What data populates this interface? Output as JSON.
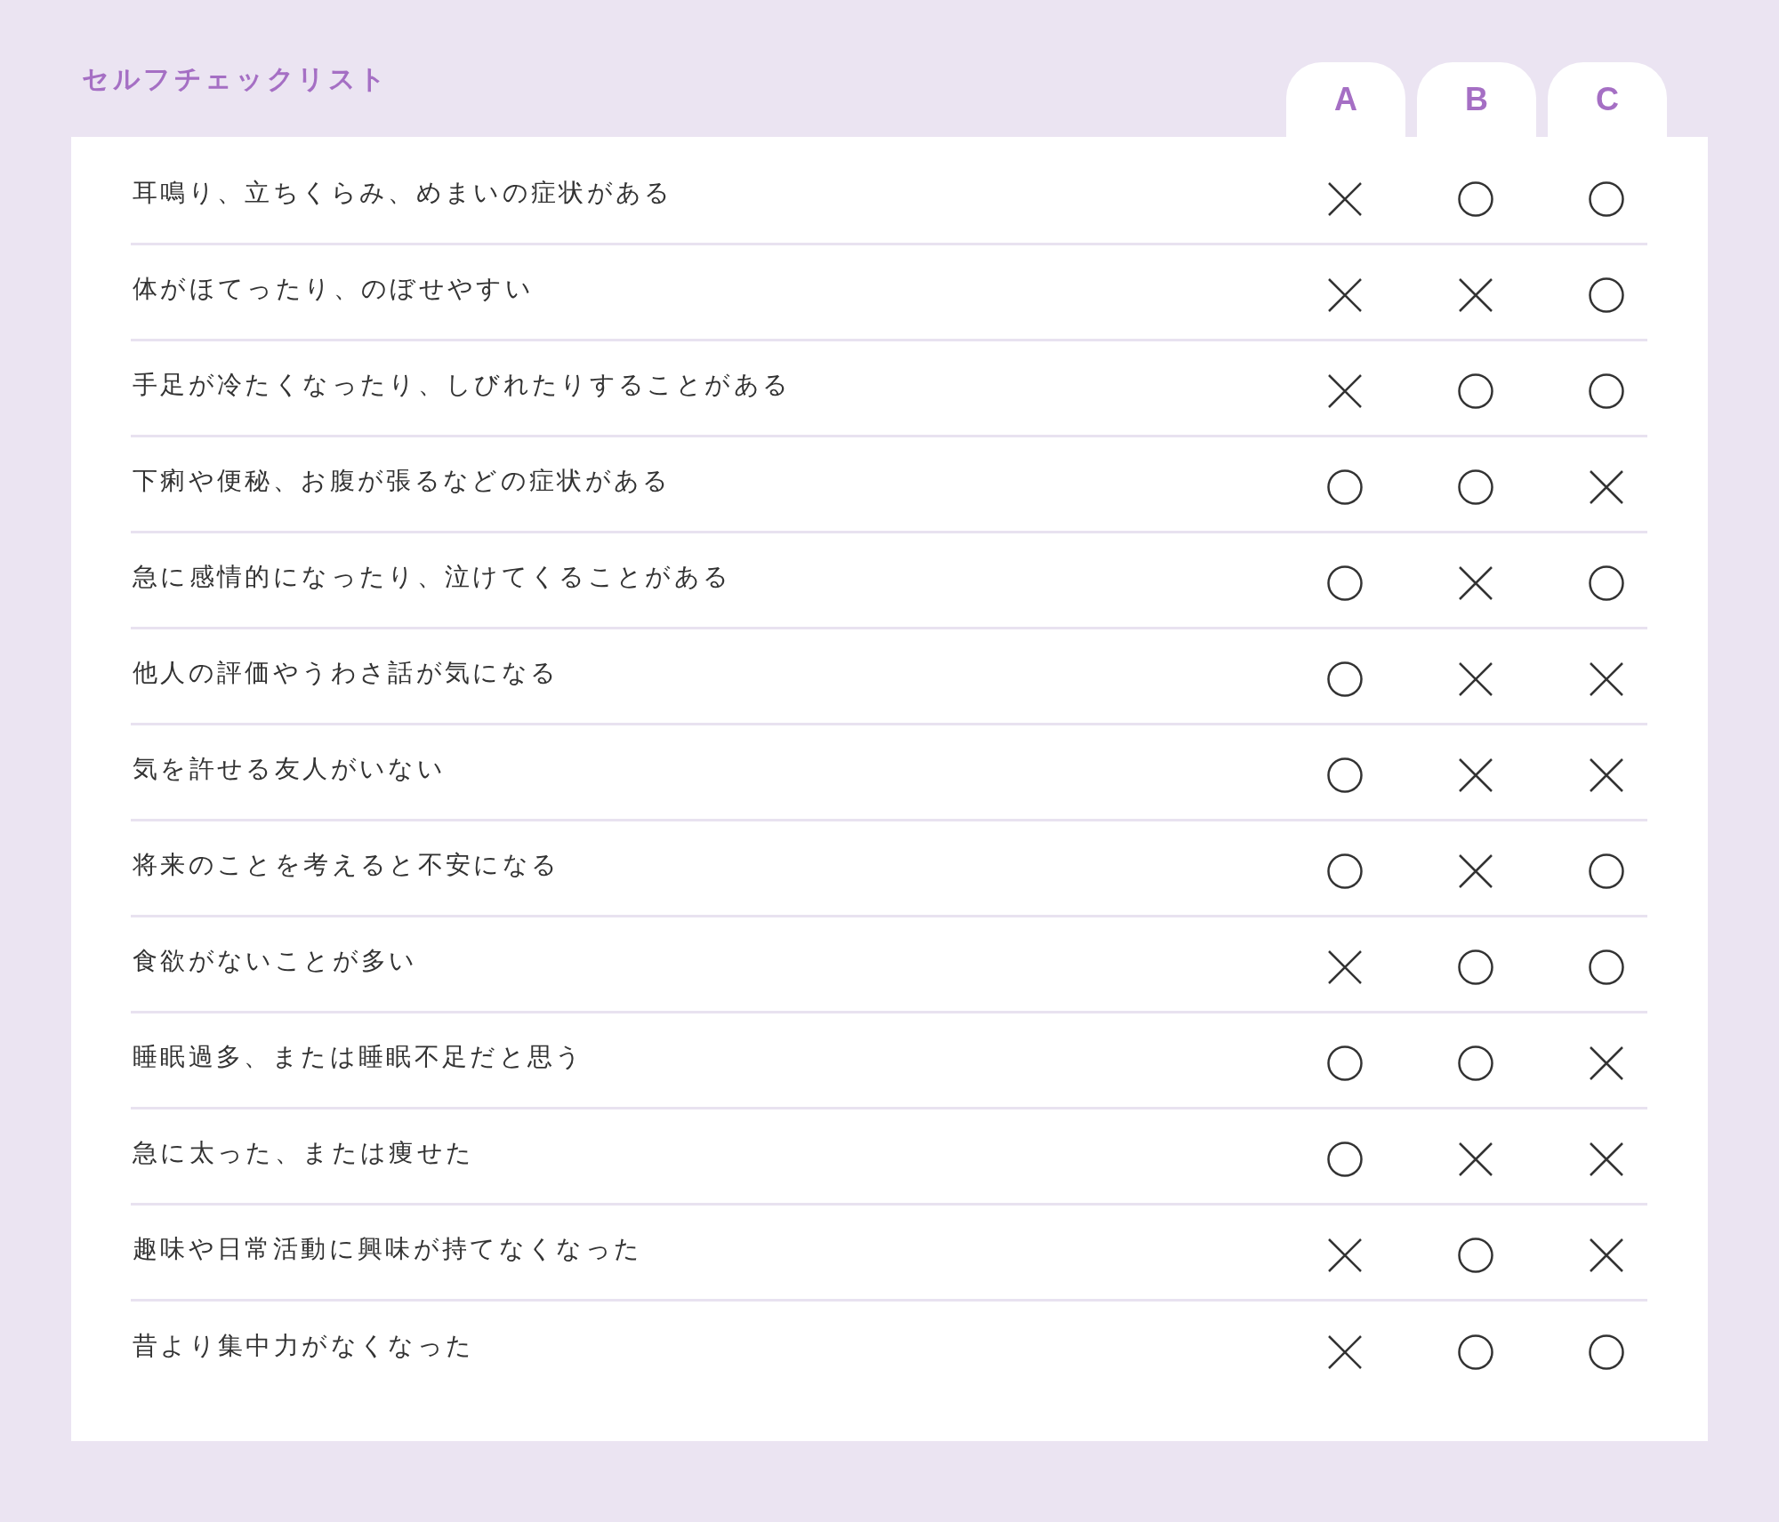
{
  "title": "セルフチェックリスト",
  "columns": [
    "A",
    "B",
    "C"
  ],
  "rows": [
    {
      "text": "耳鳴り、立ちくらみ、めまいの症状がある",
      "marks": [
        {
          "kind": "cross"
        },
        {
          "kind": "circle"
        },
        {
          "kind": "circle"
        }
      ]
    },
    {
      "text": "体がほてったり、のぼせやすい",
      "marks": [
        {
          "kind": "cross"
        },
        {
          "kind": "cross"
        },
        {
          "kind": "circle"
        }
      ]
    },
    {
      "text": "手足が冷たくなったり、しびれたりすることがある",
      "marks": [
        {
          "kind": "cross"
        },
        {
          "kind": "circle"
        },
        {
          "kind": "circle"
        }
      ]
    },
    {
      "text": "下痢や便秘、お腹が張るなどの症状がある",
      "marks": [
        {
          "kind": "circle"
        },
        {
          "kind": "circle"
        },
        {
          "kind": "cross"
        }
      ]
    },
    {
      "text": "急に感情的になったり、泣けてくることがある",
      "marks": [
        {
          "kind": "circle"
        },
        {
          "kind": "cross"
        },
        {
          "kind": "circle"
        }
      ]
    },
    {
      "text": "他人の評価やうわさ話が気になる",
      "marks": [
        {
          "kind": "circle"
        },
        {
          "kind": "cross"
        },
        {
          "kind": "cross"
        }
      ]
    },
    {
      "text": "気を許せる友人がいない",
      "marks": [
        {
          "kind": "circle"
        },
        {
          "kind": "cross"
        },
        {
          "kind": "cross"
        }
      ]
    },
    {
      "text": "将来のことを考えると不安になる",
      "marks": [
        {
          "kind": "circle"
        },
        {
          "kind": "cross"
        },
        {
          "kind": "circle"
        }
      ]
    },
    {
      "text": "食欲がないことが多い",
      "marks": [
        {
          "kind": "cross"
        },
        {
          "kind": "circle"
        },
        {
          "kind": "circle"
        }
      ]
    },
    {
      "text": "睡眠過多、または睡眠不足だと思う",
      "marks": [
        {
          "kind": "circle"
        },
        {
          "kind": "circle"
        },
        {
          "kind": "cross"
        }
      ]
    },
    {
      "text": "急に太った、または痩せた",
      "marks": [
        {
          "kind": "circle"
        },
        {
          "kind": "cross"
        },
        {
          "kind": "cross"
        }
      ]
    },
    {
      "text": "趣味や日常活動に興味が持てなくなった",
      "marks": [
        {
          "kind": "cross"
        },
        {
          "kind": "circle"
        },
        {
          "kind": "cross"
        }
      ]
    },
    {
      "text": "昔より集中力がなくなった",
      "marks": [
        {
          "kind": "cross"
        },
        {
          "kind": "circle"
        },
        {
          "kind": "circle"
        }
      ]
    }
  ]
}
